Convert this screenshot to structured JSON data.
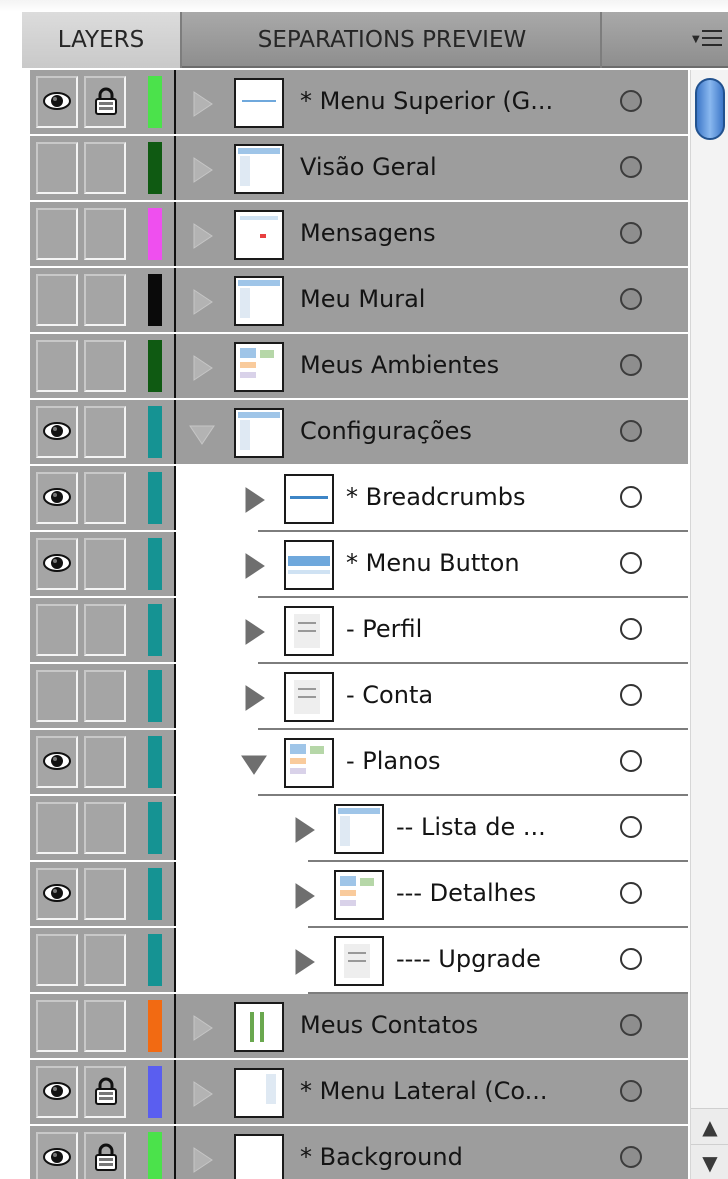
{
  "tabs": {
    "layers": "LAYERS",
    "separations": "SEPARATIONS PREVIEW"
  },
  "colors": {
    "green": "#4be24b",
    "dark_green": "#0f5a12",
    "magenta": "#ef4fef",
    "black": "#0a0a0a",
    "teal": "#159393",
    "orange": "#f26a12",
    "blue": "#5a5ef0"
  },
  "layers": [
    {
      "name": "* Menu Superior (G...",
      "level": 0,
      "expanded": false,
      "visible": true,
      "locked": true,
      "color": "#4be24b",
      "thumb": "bar"
    },
    {
      "name": "Visão Geral",
      "level": 0,
      "expanded": false,
      "visible": false,
      "locked": false,
      "color": "#0f5a12",
      "thumb": "page"
    },
    {
      "name": "Mensagens",
      "level": 0,
      "expanded": false,
      "visible": false,
      "locked": false,
      "color": "#ef4fef",
      "thumb": "dot"
    },
    {
      "name": "Meu Mural",
      "level": 0,
      "expanded": false,
      "visible": false,
      "locked": false,
      "color": "#0a0a0a",
      "thumb": "page"
    },
    {
      "name": "Meus Ambientes",
      "level": 0,
      "expanded": false,
      "visible": false,
      "locked": false,
      "color": "#0f5a12",
      "thumb": "grid"
    },
    {
      "name": "Configurações",
      "level": 0,
      "expanded": true,
      "visible": true,
      "locked": false,
      "color": "#159393",
      "thumb": "page"
    },
    {
      "name": "* Breadcrumbs",
      "level": 1,
      "expanded": false,
      "visible": true,
      "locked": false,
      "color": "#159393",
      "thumb": "line"
    },
    {
      "name": "* Menu Button",
      "level": 1,
      "expanded": false,
      "visible": true,
      "locked": false,
      "color": "#159393",
      "thumb": "band"
    },
    {
      "name": "- Perfil",
      "level": 1,
      "expanded": false,
      "visible": false,
      "locked": false,
      "color": "#159393",
      "thumb": "form"
    },
    {
      "name": "- Conta",
      "level": 1,
      "expanded": false,
      "visible": false,
      "locked": false,
      "color": "#159393",
      "thumb": "form"
    },
    {
      "name": "- Planos",
      "level": 1,
      "expanded": true,
      "visible": true,
      "locked": false,
      "color": "#159393",
      "thumb": "grid"
    },
    {
      "name": "-- Lista de ...",
      "level": 2,
      "expanded": false,
      "visible": false,
      "locked": false,
      "color": "#159393",
      "thumb": "page"
    },
    {
      "name": "--- Detalhes",
      "level": 2,
      "expanded": false,
      "visible": true,
      "locked": false,
      "color": "#159393",
      "thumb": "grid"
    },
    {
      "name": "---- Upgrade",
      "level": 2,
      "expanded": false,
      "visible": false,
      "locked": false,
      "color": "#159393",
      "thumb": "form"
    },
    {
      "name": "Meus Contatos",
      "level": 0,
      "expanded": false,
      "visible": false,
      "locked": false,
      "color": "#f26a12",
      "thumb": "cols"
    },
    {
      "name": "* Menu Lateral (Co...",
      "level": 0,
      "expanded": false,
      "visible": true,
      "locked": true,
      "color": "#5a5ef0",
      "thumb": "side"
    },
    {
      "name": "* Background",
      "level": 0,
      "expanded": false,
      "visible": true,
      "locked": true,
      "color": "#4be24b",
      "thumb": "blank"
    }
  ]
}
